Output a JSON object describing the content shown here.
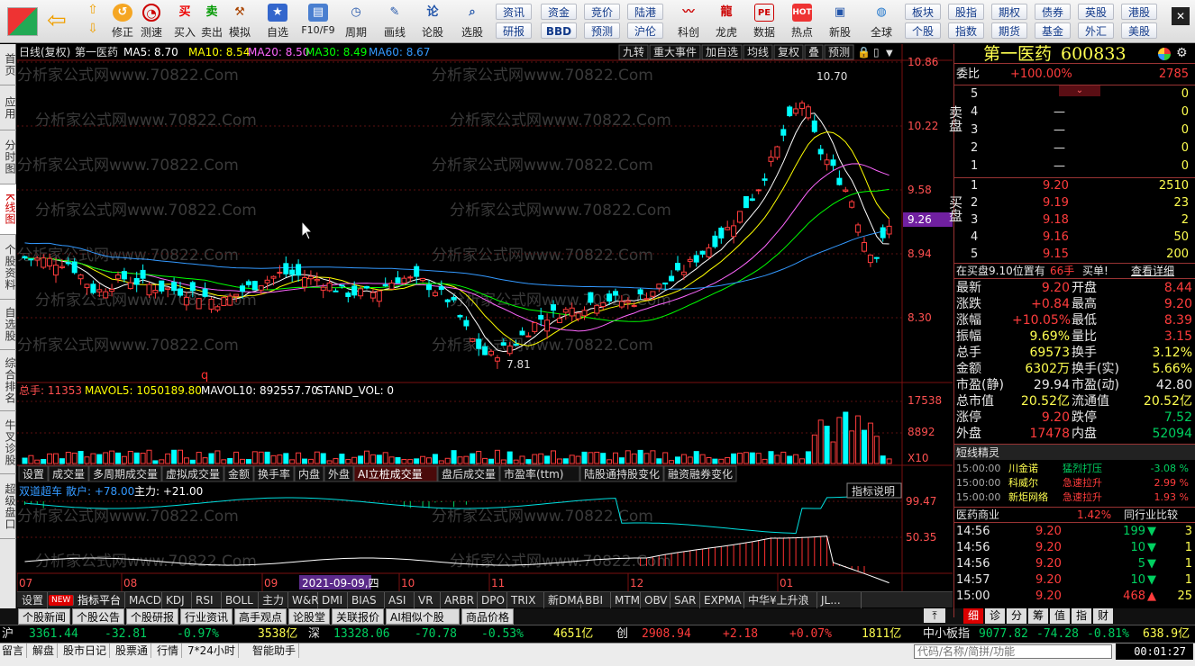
{
  "toolbar": {
    "top_buttons": [
      {
        "label": "修正",
        "icon": "undo-icon"
      },
      {
        "label": "测速",
        "icon": "clock-icon"
      },
      {
        "label": "买入",
        "glyph": "买"
      },
      {
        "label": "卖出",
        "glyph": "卖"
      },
      {
        "label": "模拟",
        "icon": "hammer-icon"
      },
      {
        "label": "自选",
        "icon": "star-icon"
      },
      {
        "label": "F10/F9",
        "icon": "card-icon"
      },
      {
        "label": "周期",
        "icon": "cycle-icon"
      },
      {
        "label": "画线",
        "icon": "pen-icon"
      },
      {
        "label": "论股",
        "glyph": "论"
      },
      {
        "label": "选股",
        "icon": "search-chart-icon"
      }
    ],
    "grid_top": [
      "资讯",
      "资金",
      "竞价",
      "陆港"
    ],
    "grid_bottom": [
      "研报",
      "BBD",
      "预测",
      "沪伦"
    ],
    "big_buttons": [
      {
        "label": "科创"
      },
      {
        "label": "龙虎"
      },
      {
        "label": "数据",
        "glyph": "PE"
      },
      {
        "label": "热点",
        "glyph": "HOT"
      },
      {
        "label": "新股"
      },
      {
        "label": "全球"
      }
    ],
    "grid2_top": [
      "板块",
      "股指",
      "期权",
      "债券",
      "英股",
      "港股"
    ],
    "grid2_bottom": [
      "个股",
      "指数",
      "期货",
      "基金",
      "外汇",
      "美股"
    ]
  },
  "left_tabs": [
    "首页",
    "应用",
    "分时图",
    "K线图",
    "个股资料",
    "自选股",
    "综合排名",
    "牛叉诊股",
    "超级盘口"
  ],
  "chart": {
    "header": {
      "period": "日线(复权)",
      "name": "第一医药",
      "ma5": "MA5: 8.70",
      "ma10": "MA10: 8.54",
      "ma20": "MA20: 8.50",
      "ma30": "MA30: 8.49",
      "ma60": "MA60: 8.67"
    },
    "top_buttons": [
      "九转",
      "重大事件",
      "加自选",
      "均线",
      "复权",
      "叠",
      "预测"
    ],
    "price_axis": [
      "10.86",
      "10.22",
      "9.58",
      "8.94",
      "8.30"
    ],
    "current_price_tag": "9.26",
    "high_label": "10.70",
    "low_label": "7.81",
    "vol_header": {
      "total": "总手: 11353",
      "mavol5": "MAVOL5: 1050189.80",
      "mavol10": "MAVOL10: 892557.70",
      "stand": "STAND_VOL: 0"
    },
    "vol_axis": [
      "17538",
      "8892",
      "X10"
    ],
    "sub_tabs": [
      "设置",
      "成交量",
      "多周期成交量",
      "虚拟成交量",
      "金额",
      "换手率",
      "内盘",
      "外盘",
      "AI立桩成交量",
      "盘后成交量",
      "市盈率(ttm)",
      "陆股通持股变化",
      "融资融券变化"
    ],
    "ind_header": {
      "name": "双道超车",
      "retail": "散户: +78.00",
      "main": "主力: +21.00"
    },
    "ind_button": "指标说明",
    "ind_axis": [
      "99.47",
      "50.35"
    ],
    "months": [
      "07",
      "08",
      "09",
      "10",
      "11",
      "12",
      "01"
    ],
    "date_label": "2021-09-09,四",
    "watermark": "分析家公式网www.70822.Com",
    "marker_q": "q"
  },
  "bottom_tabs": [
    "设置",
    "NEW",
    "指标平台",
    "MACD",
    "KDJ",
    "RSI",
    "BOLL",
    "主力",
    "W&R",
    "DMI",
    "BIAS",
    "ASI",
    "VR",
    "ARBR",
    "DPO",
    "TRIX",
    "新DMA",
    "BBI",
    "MTM",
    "OBV",
    "SAR",
    "EXPMA",
    "中华¥上升浪",
    "JL..."
  ],
  "news_tabs": [
    "个股新闻",
    "个股公告",
    "个股研报",
    "行业资讯",
    "高手观点",
    "论股堂",
    "关联报价",
    "AI相似个股",
    "商品价格"
  ],
  "quote": {
    "title": "第一医药",
    "code": "600833",
    "weibi_label": "委比",
    "weibi": "+100.00%",
    "weicha": "2785",
    "sell_label": "卖盘",
    "buy_label": "买盘",
    "sell": [
      {
        "n": "5",
        "p": "",
        "v": "0"
      },
      {
        "n": "4",
        "p": "—",
        "v": "0"
      },
      {
        "n": "3",
        "p": "—",
        "v": "0"
      },
      {
        "n": "2",
        "p": "—",
        "v": "0"
      },
      {
        "n": "1",
        "p": "—",
        "v": "0"
      }
    ],
    "buy": [
      {
        "n": "1",
        "p": "9.20",
        "v": "2510"
      },
      {
        "n": "2",
        "p": "9.19",
        "v": "23"
      },
      {
        "n": "3",
        "p": "9.18",
        "v": "2"
      },
      {
        "n": "4",
        "p": "9.16",
        "v": "50"
      },
      {
        "n": "5",
        "p": "9.15",
        "v": "200"
      }
    ],
    "note": "在买盘9.10位置有",
    "note_vol": "66手",
    "note_buy": "买单!",
    "note_link": "查看详细",
    "stats": [
      [
        "最新",
        "9.20",
        "red",
        "开盘",
        "8.44",
        "red"
      ],
      [
        "涨跌",
        "+0.84",
        "red",
        "最高",
        "9.20",
        "red"
      ],
      [
        "涨幅",
        "+10.05%",
        "red",
        "最低",
        "8.39",
        "red"
      ],
      [
        "振幅",
        "9.69%",
        "yel",
        "量比",
        "3.15",
        "red"
      ],
      [
        "总手",
        "69573",
        "yel",
        "换手",
        "3.12%",
        "yel"
      ],
      [
        "金额",
        "6302万",
        "yel",
        "换手(实)",
        "5.66%",
        "yel"
      ],
      [
        "市盈(静)",
        "29.94",
        "wht",
        "市盈(动)",
        "42.80",
        "wht"
      ],
      [
        "总市值",
        "20.52亿",
        "yel",
        "流通值",
        "20.52亿",
        "yel"
      ],
      [
        "涨停",
        "9.20",
        "red",
        "跌停",
        "7.52",
        "grn"
      ],
      [
        "外盘",
        "17478",
        "red",
        "内盘",
        "52094",
        "grn"
      ]
    ],
    "elves_title": "短线精灵",
    "elves": [
      {
        "t": "15:00:00",
        "name": "川金诺",
        "evt": "猛烈打压",
        "val": "-3.08 %",
        "c": "grn"
      },
      {
        "t": "15:00:00",
        "name": "科威尔",
        "evt": "急速拉升",
        "val": "2.99 %",
        "c": "red"
      },
      {
        "t": "15:00:00",
        "name": "新炬网络",
        "evt": "急速拉升",
        "val": "1.93 %",
        "c": "red"
      }
    ],
    "industry": "医药商业",
    "industry_pct": "1.42%",
    "industry_cmp": "同行业比较",
    "ticks": [
      {
        "t": "14:56",
        "p": "9.20",
        "v": "199",
        "d": "down",
        "n": "3"
      },
      {
        "t": "14:56",
        "p": "9.20",
        "v": "10",
        "d": "down",
        "n": "1"
      },
      {
        "t": "14:56",
        "p": "9.20",
        "v": "5",
        "d": "down",
        "n": "1"
      },
      {
        "t": "14:57",
        "p": "9.20",
        "v": "10",
        "d": "down",
        "n": "1"
      },
      {
        "t": "15:00",
        "p": "9.20",
        "v": "468",
        "d": "up",
        "n": "25"
      }
    ],
    "tabs": [
      "细",
      "诊",
      "分",
      "筹",
      "值",
      "指",
      "财"
    ]
  },
  "index_bar": {
    "sh_label": "沪",
    "sh": "3361.44",
    "sh_chg": "-32.81",
    "sh_pct": "-0.97%",
    "sh_amt": "3538亿",
    "sz_label": "深",
    "sz": "13328.06",
    "sz_chg": "-70.78",
    "sz_pct": "-0.53%",
    "sz_amt": "4651亿",
    "cy_label": "创",
    "cy": "2908.94",
    "cy_chg": "+2.18",
    "cy_pct": "+0.07%",
    "cy_amt": "1811亿",
    "zx_label": "中小板指",
    "zx": "9077.82",
    "zx_chg": "-74.28",
    "zx_pct": "-0.81%",
    "zx_amt": "638.9亿"
  },
  "status_bar": {
    "items": [
      "留言",
      "解盘",
      "股市日记",
      "股票通",
      "行情",
      "7*24小时",
      "智能助手"
    ],
    "search_placeholder": "代码/名称/简拼/功能",
    "time": "00:01:27"
  },
  "colors": {
    "up": "#ff3c3c",
    "down": "#00ffff",
    "ma5": "#ffffff",
    "ma10": "#ffff00",
    "ma20": "#ff66ff",
    "ma30": "#00ff00",
    "ma60": "#3399ff"
  }
}
